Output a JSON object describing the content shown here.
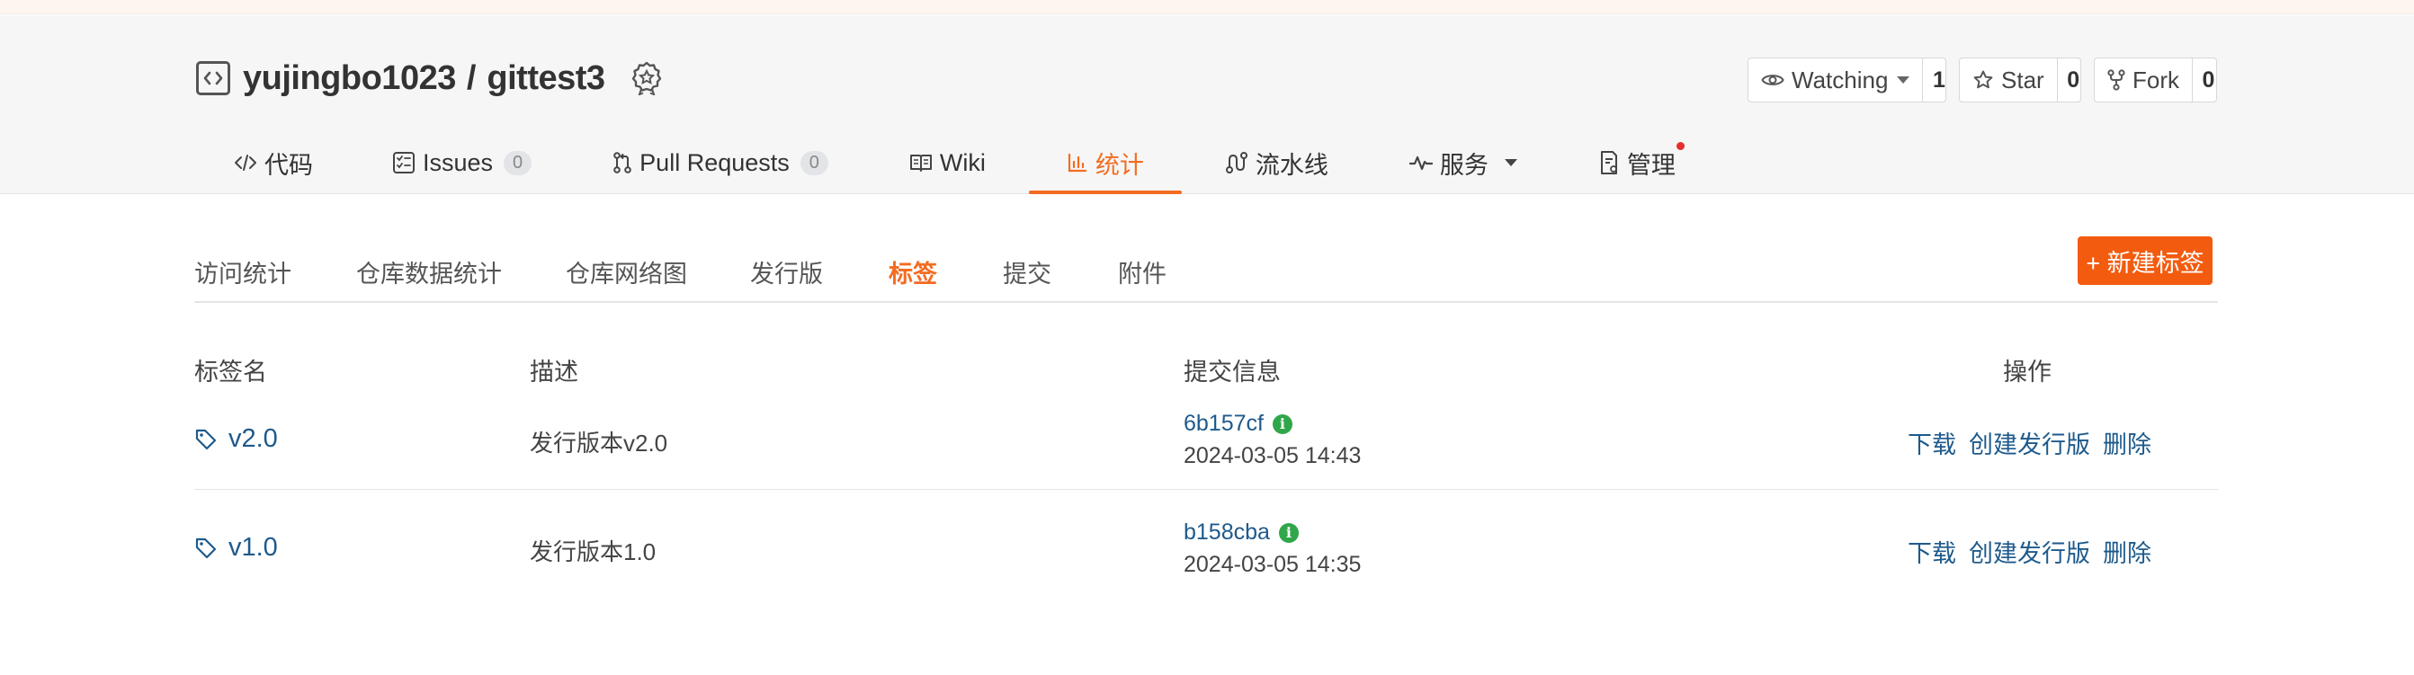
{
  "repo": {
    "owner": "yujingbo1023",
    "separator": "/",
    "name": "gittest3"
  },
  "actions": {
    "watch": {
      "label": "Watching",
      "count": "1"
    },
    "star": {
      "label": "Star",
      "count": "0"
    },
    "fork": {
      "label": "Fork",
      "count": "0"
    }
  },
  "nav": {
    "code": "代码",
    "issues": "Issues",
    "issues_count": "0",
    "pulls": "Pull Requests",
    "pulls_count": "0",
    "wiki": "Wiki",
    "stats": "统计",
    "pipeline": "流水线",
    "services": "服务",
    "manage": "管理"
  },
  "subnav": {
    "items": [
      "访问统计",
      "仓库数据统计",
      "仓库网络图",
      "发行版",
      "标签",
      "提交",
      "附件"
    ],
    "active": "标签",
    "new_tag": "+ 新建标签"
  },
  "table": {
    "headers": {
      "name": "标签名",
      "desc": "描述",
      "commit": "提交信息",
      "ops": "操作"
    },
    "rows": [
      {
        "name": "v2.0",
        "desc": "发行版本v2.0",
        "sha": "6b157cf",
        "date": "2024-03-05 14:43"
      },
      {
        "name": "v1.0",
        "desc": "发行版本1.0",
        "sha": "b158cba",
        "date": "2024-03-05 14:35"
      }
    ],
    "ops": {
      "download": "下载",
      "create_release": "创建发行版",
      "delete": "删除"
    }
  },
  "colors": {
    "accent": "#f36c21",
    "link": "#1e5a8c",
    "info": "#2fa64a",
    "button": "#f35b0f"
  }
}
